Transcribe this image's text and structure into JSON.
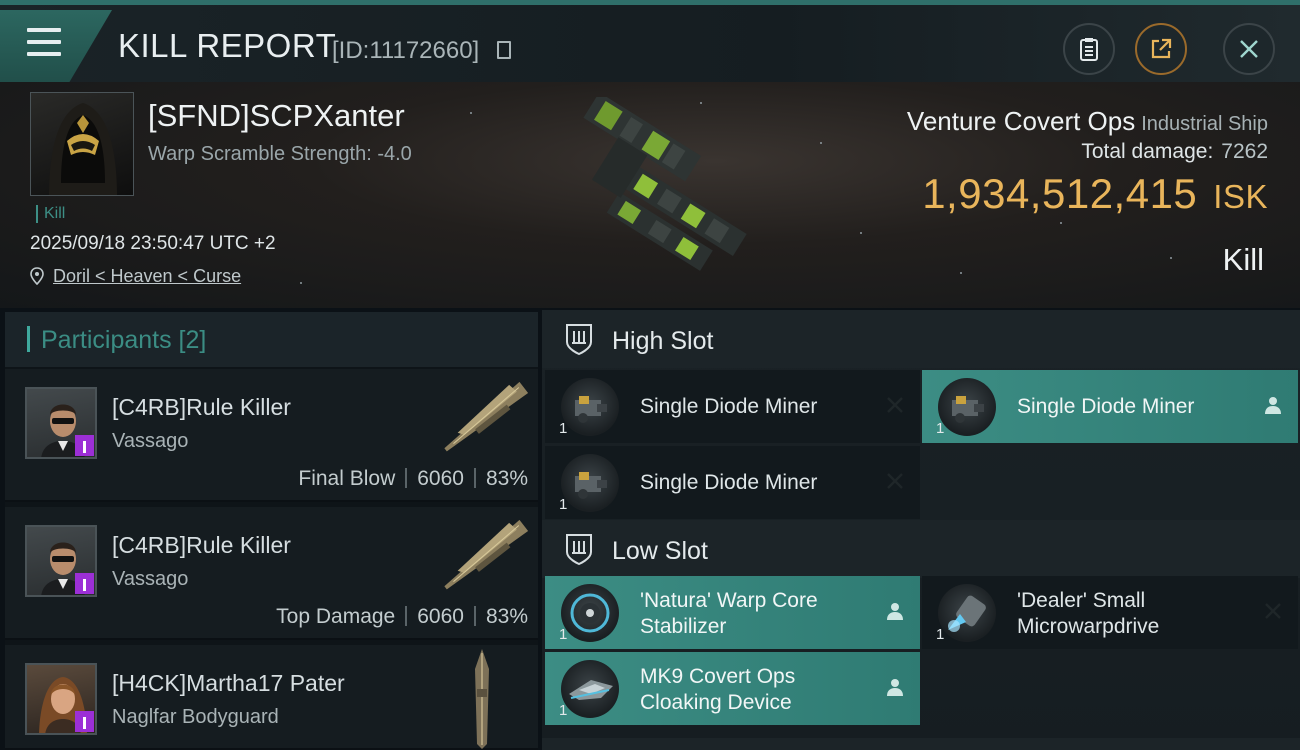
{
  "header": {
    "title": "KILL REPORT",
    "report_id": "[ID:11172660]",
    "buttons": {
      "report_icon": "clipboard-icon",
      "share_icon": "share-icon",
      "close_icon": "close-icon"
    }
  },
  "victim": {
    "name": "[SFND]SCPXanter",
    "warp_scramble": "Warp Scramble Strength: -4.0",
    "tag": "Kill",
    "datetime": "2025/09/18 23:50:47 UTC +2",
    "location": "Doril < Heaven < Curse",
    "ship_name": "Venture Covert Ops",
    "ship_class": "Industrial Ship",
    "total_damage_label": "Total damage:",
    "total_damage_value": "7262",
    "isk_value": "1,934,512,415",
    "isk_unit": "ISK",
    "result": "Kill"
  },
  "participants": {
    "label": "Participants [2]",
    "rows": [
      {
        "name": "[C4RB]Rule Killer",
        "ship": "Vassago",
        "role": "Final Blow",
        "damage": "6060",
        "percent": "83%"
      },
      {
        "name": "[C4RB]Rule Killer",
        "ship": "Vassago",
        "role": "Top Damage",
        "damage": "6060",
        "percent": "83%"
      },
      {
        "name": "[H4CK]Martha17 Pater",
        "ship": "Naglfar Bodyguard"
      }
    ]
  },
  "fittings": {
    "high_slot_label": "High Slot",
    "low_slot_label": "Low Slot",
    "high_slot": [
      {
        "name": "Single Diode Miner",
        "qty": "1",
        "status": "destroyed"
      },
      {
        "name": "Single Diode Miner",
        "qty": "1",
        "status": "dropped"
      },
      {
        "name": "Single Diode Miner",
        "qty": "1",
        "status": "destroyed"
      }
    ],
    "low_slot": [
      {
        "name": "'Natura' Warp Core Stabilizer",
        "qty": "1",
        "status": "dropped"
      },
      {
        "name": "'Dealer' Small Microwarpdrive",
        "qty": "1",
        "status": "destroyed"
      },
      {
        "name": "MK9 Covert Ops Cloaking Device",
        "qty": "1",
        "status": "dropped"
      }
    ]
  },
  "colors": {
    "accent_teal": "#3c8d84",
    "isk_gold": "#e9b55b",
    "badge_purple": "#9c2fd6"
  }
}
